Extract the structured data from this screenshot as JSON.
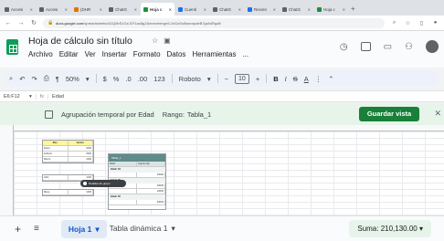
{
  "browser": {
    "tabs": [
      {
        "label": "Accesi"
      },
      {
        "label": "Accesi"
      },
      {
        "label": "(DHR"
      },
      {
        "label": "ChatG"
      },
      {
        "label": "Hoja c",
        "active": true
      },
      {
        "label": "Cuenti"
      },
      {
        "label": "ChatG"
      },
      {
        "label": "Recien"
      },
      {
        "label": "ChatG"
      },
      {
        "label": "Hoja c"
      }
    ],
    "new_tab": "+",
    "url_host": "docs.google.com",
    "url_path": "/spreadsheets/d/1Q0bS1GzJ1F1ac8gJ1kemvmergn9.2xGzOu8ssnnpdeB7gsh4Rgdit"
  },
  "sheets": {
    "doc_title": "Hoja de cálculo sin título",
    "menu": [
      "Archivo",
      "Editar",
      "Ver",
      "Insertar",
      "Formato",
      "Datos",
      "Herramientas",
      "..."
    ],
    "toolbar": {
      "zoom": "50%",
      "currency": "$",
      "percent": "%",
      "dec_less": ".0",
      "dec_more": ".00",
      "number_format": "123",
      "font": "Roboto",
      "font_size": "10",
      "bold": "B",
      "italic": "I",
      "font_color": "A"
    },
    "name_box": "E6:F12",
    "formula": "Edad",
    "fx": "fx",
    "pivot_bar": {
      "label": "Agrupación temporal por Edad",
      "range_label": "Rango:",
      "range_value": "Tabla_1",
      "save_button": "Guardar vista"
    },
    "source_table": {
      "headers": [
        "Mes",
        "Ventas"
      ],
      "rows": [
        [
          "Enero",
          "1000"
        ],
        [
          "Febrero",
          "1500"
        ],
        [
          "Marzo",
          "1200"
        ]
      ]
    },
    "second_table": {
      "rows": [
        [
          "Abril",
          "1100"
        ],
        [
          "Mayo",
          "1400"
        ]
      ]
    },
    "pivot_table": {
      "title": "Tabla_1",
      "headers": [
        "Edad",
        "Ingreso ($)"
      ],
      "groups": [
        "Edad: 18",
        "Edad: 25",
        "Edad: 30"
      ],
      "values": [
        "15000",
        "10000",
        "12000",
        "20000"
      ]
    },
    "tooltip": "Detalles de grupo",
    "sheet_tabs": [
      {
        "label": "Hoja 1",
        "active": true
      },
      {
        "label": "Tabla dinámica 1",
        "active": false
      }
    ],
    "status_sum": "Suma: 210,130.00"
  }
}
